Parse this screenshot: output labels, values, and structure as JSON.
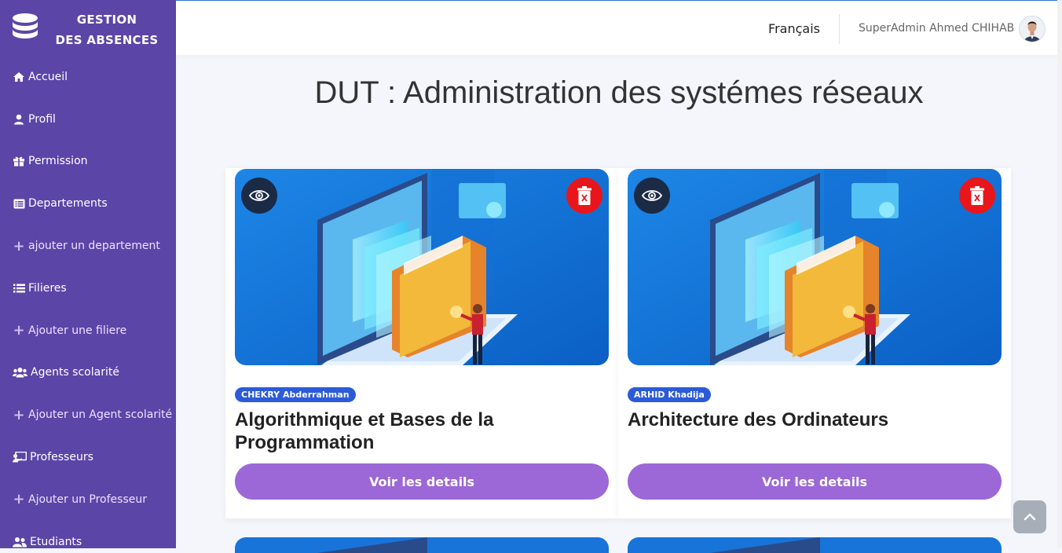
{
  "brand": {
    "line1": "GESTION",
    "line2": "DES ABSENCES",
    "icon": "database-icon"
  },
  "sidebar": {
    "items": [
      {
        "label": "Accueil",
        "icon": "home-icon",
        "sub": false
      },
      {
        "label": "Profil",
        "icon": "user-icon",
        "sub": false
      },
      {
        "label": "Permission",
        "icon": "gift-icon",
        "sub": false
      },
      {
        "label": "Departements",
        "icon": "list-alt-icon",
        "sub": false
      },
      {
        "label": "ajouter un departement",
        "icon": "plus-icon",
        "sub": true
      },
      {
        "label": "Filieres",
        "icon": "list-icon",
        "sub": false
      },
      {
        "label": "Ajouter une filiere",
        "icon": "plus-icon",
        "sub": true
      },
      {
        "label": "Agents scolarité",
        "icon": "users-icon",
        "sub": false
      },
      {
        "label": "Ajouter un Agent scolarité",
        "icon": "plus-icon",
        "sub": true
      },
      {
        "label": "Professeurs",
        "icon": "chalkboard-teacher-icon",
        "sub": false
      },
      {
        "label": "Ajouter un Professeur",
        "icon": "plus-icon",
        "sub": true
      },
      {
        "label": "Etudiants",
        "icon": "user-friends-icon",
        "sub": false
      }
    ]
  },
  "header": {
    "language": "Français",
    "user": "SuperAdmin Ahmed CHIHAB"
  },
  "page": {
    "title": "DUT : Administration des systémes réseaux"
  },
  "cards": [
    {
      "teacher": "CHEKRY Abderrahman",
      "course": "Algorithmique et Bases de la Programmation",
      "button": "Voir les details"
    },
    {
      "teacher": "ARHID Khadija",
      "course": "Architecture des Ordinateurs",
      "button": "Voir les details"
    }
  ],
  "colors": {
    "sidebar": "#5b45a7",
    "button": "#9c67d6",
    "badge": "#2c5bd8",
    "delete": "#e8161b"
  }
}
